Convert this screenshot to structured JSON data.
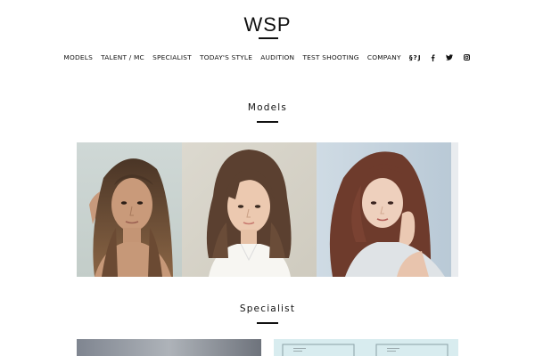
{
  "brand": {
    "logo": "WSP"
  },
  "nav": {
    "items": [
      "MODELS",
      "TALENT / MC",
      "SPECIALIST",
      "TODAY'S STYLE",
      "AUDITION",
      "TEST SHOOTING",
      "COMPANY"
    ],
    "extra_label": "§?J",
    "social": [
      "facebook-icon",
      "twitter-icon",
      "instagram-icon"
    ]
  },
  "sections": {
    "models": {
      "title": "Models"
    },
    "specialist": {
      "title": "Specialist"
    }
  },
  "colors": {
    "text": "#111111",
    "background": "#ffffff"
  }
}
